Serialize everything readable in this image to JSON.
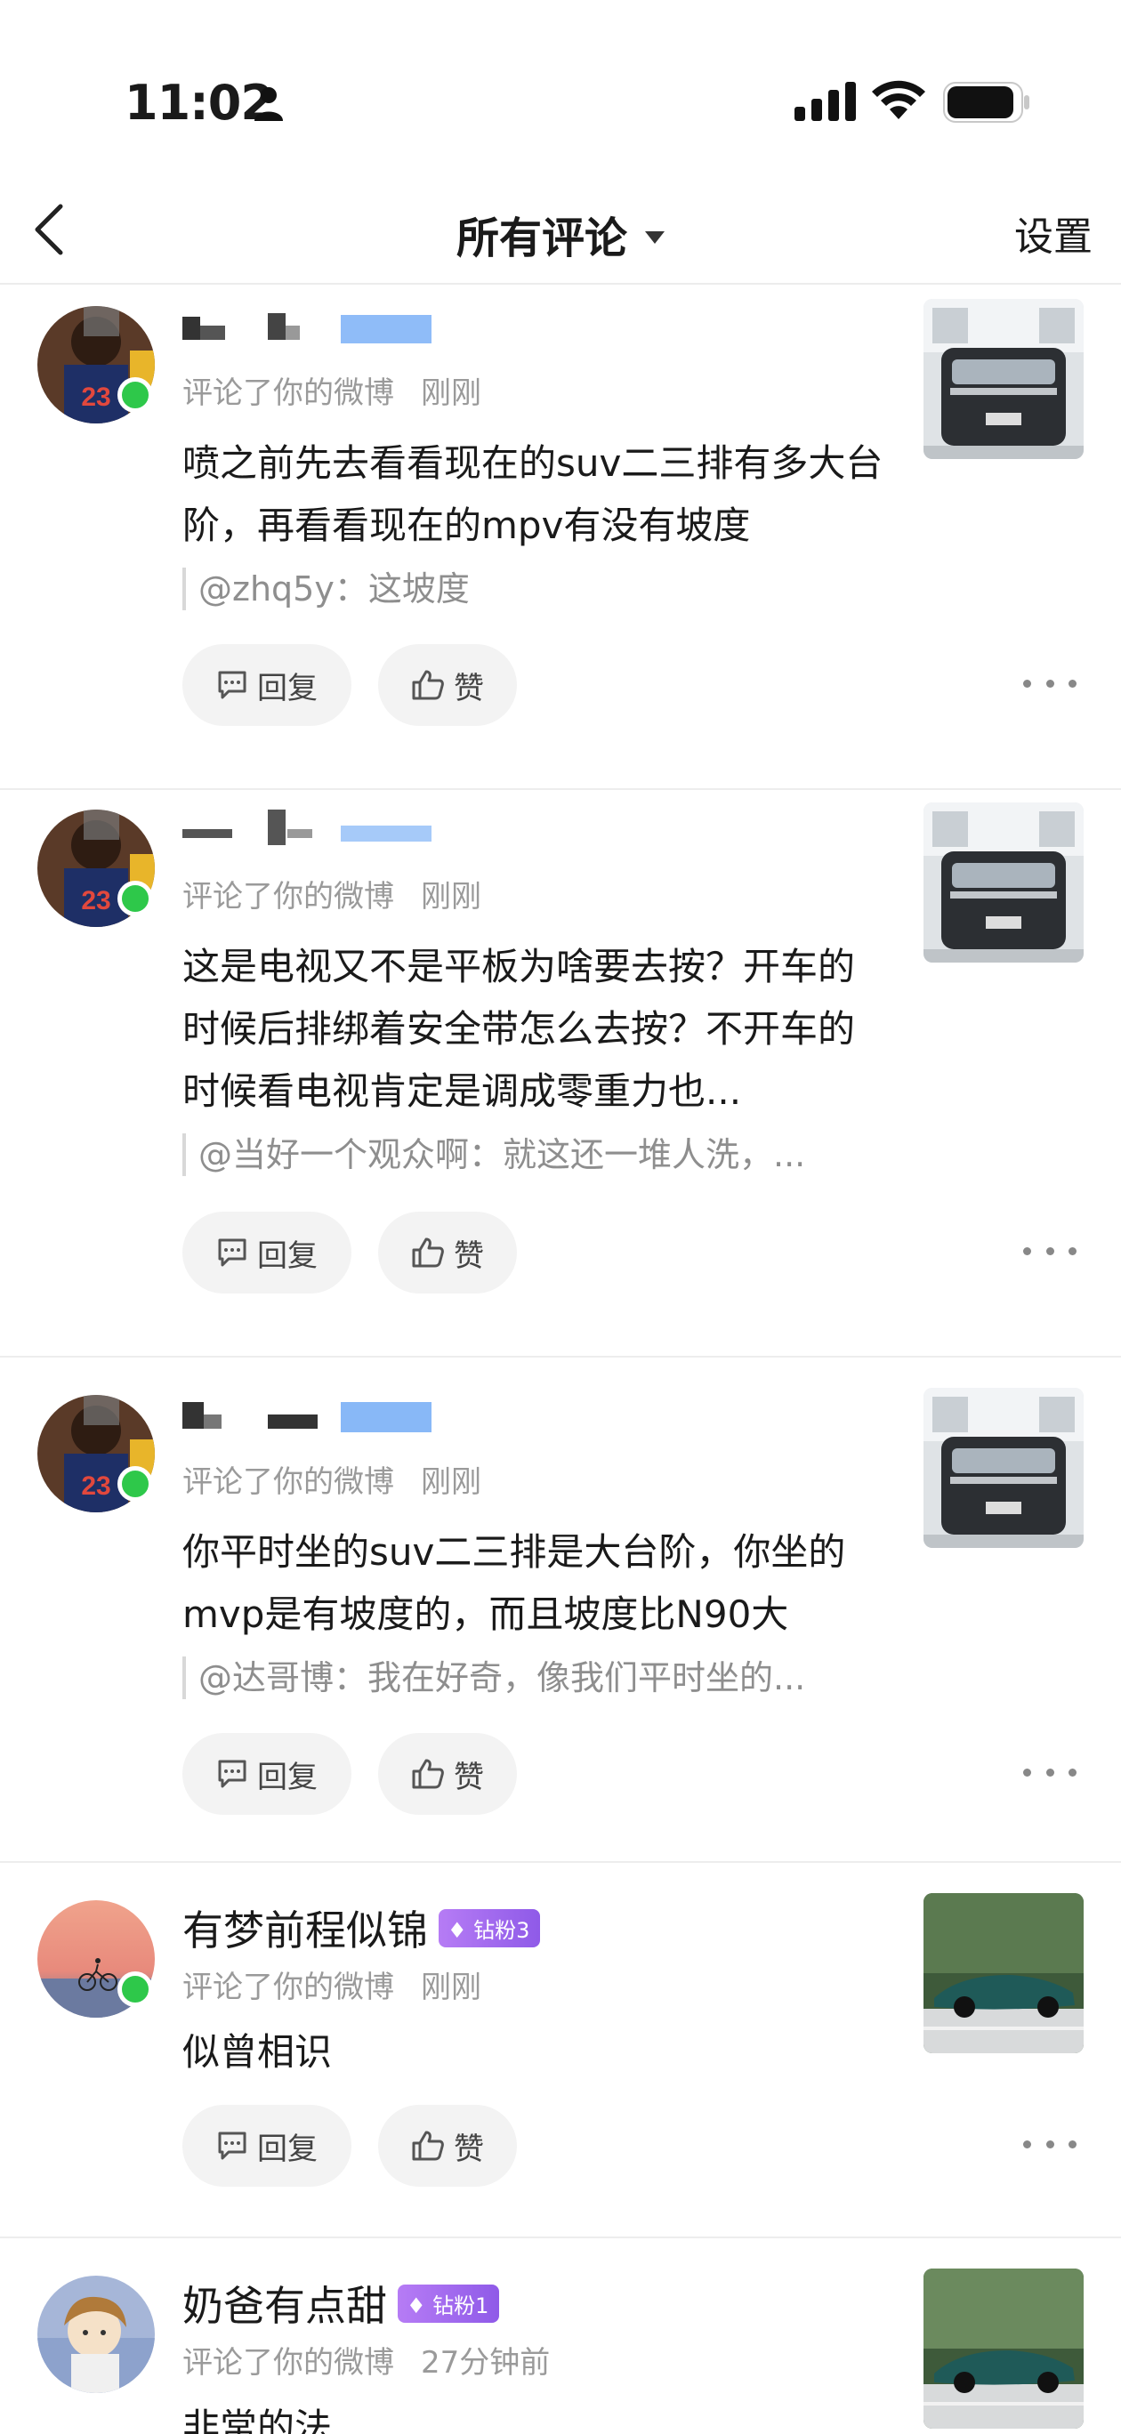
{
  "status_bar": {
    "time": "11:02",
    "icons": [
      "person-icon",
      "signal-icon",
      "wifi-icon",
      "battery-icon"
    ]
  },
  "nav": {
    "title": "所有评论",
    "settings_label": "设置"
  },
  "actions": {
    "reply_label": "回复",
    "like_label": "赞"
  },
  "comments": [
    {
      "username": "",
      "meta_source": "评论了你的微博",
      "meta_time": "刚刚",
      "text": "喷之前先去看看现在的suv二三排有多大台阶，再看看现在的mpv有没有坡度",
      "quote": "@zhq5y：这坡度",
      "online": true
    },
    {
      "username": "",
      "meta_source": "评论了你的微博",
      "meta_time": "刚刚",
      "text": "这是电视又不是平板为啥要去按？开车的时候后排绑着安全带怎么去按？不开车的时候看电视肯定是调成零重力也...",
      "quote": "@当好一个观众啊：就这还一堆人洗，...",
      "online": true
    },
    {
      "username": "",
      "meta_source": "评论了你的微博",
      "meta_time": "刚刚",
      "text": "你平时坐的suv二三排是大台阶，你坐的mvp是有坡度的，而且坡度比N90大",
      "quote": "@达哥博：我在好奇，像我们平时坐的...",
      "online": true
    },
    {
      "username": "有梦前程似锦",
      "badge": "钻粉3",
      "meta_source": "评论了你的微博",
      "meta_time": "刚刚",
      "text": "似曾相识",
      "online": true
    },
    {
      "username": "奶爸有点甜",
      "badge": "钻粉1",
      "meta_source": "评论了你的微博",
      "meta_time": "27分钟前",
      "text": "非常的法",
      "online": false
    }
  ]
}
